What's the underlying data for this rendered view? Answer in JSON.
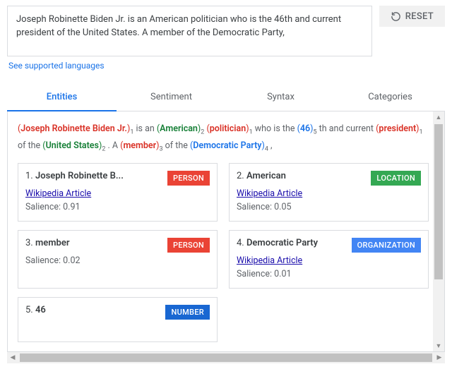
{
  "input_text": "Joseph Robinette Biden Jr. is an American politician who is the 46th and current president of the United States. A member of the Democratic Party,",
  "reset_label": "RESET",
  "supported_languages_label": "See supported languages",
  "tabs": [
    {
      "id": "entities",
      "label": "Entities"
    },
    {
      "id": "sentiment",
      "label": "Sentiment"
    },
    {
      "id": "syntax",
      "label": "Syntax"
    },
    {
      "id": "categories",
      "label": "Categories"
    }
  ],
  "active_tab": "entities",
  "analysis_tokens": [
    {
      "kind": "entity",
      "text": "Joseph Robinette Biden Jr.",
      "type": "PERSON",
      "mention_index": 1
    },
    {
      "kind": "text",
      "text": " is an "
    },
    {
      "kind": "entity",
      "text": "American",
      "type": "LOCATION",
      "mention_index": 2
    },
    {
      "kind": "text",
      "text": " "
    },
    {
      "kind": "entity",
      "text": "politician",
      "type": "PERSON",
      "mention_index": 1
    },
    {
      "kind": "text",
      "text": " who is the "
    },
    {
      "kind": "entity",
      "text": "46",
      "type": "NUMBER",
      "mention_index": 5
    },
    {
      "kind": "text",
      "text": " th and current "
    },
    {
      "kind": "entity",
      "text": "president",
      "type": "PERSON",
      "mention_index": 1
    },
    {
      "kind": "text",
      "text": " of the "
    },
    {
      "kind": "entity",
      "text": "United States",
      "type": "LOCATION",
      "mention_index": 2
    },
    {
      "kind": "text",
      "text": " . A "
    },
    {
      "kind": "entity",
      "text": "member",
      "type": "PERSON",
      "mention_index": 3
    },
    {
      "kind": "text",
      "text": " of the "
    },
    {
      "kind": "entity",
      "text": "Democratic Party",
      "type": "ORGANIZATION",
      "mention_index": 4
    },
    {
      "kind": "text",
      "text": " ,"
    }
  ],
  "salience_label": "Salience",
  "wiki_label": "Wikipedia Article",
  "entities": [
    {
      "index": 1,
      "name": "Joseph Robinette B...",
      "type": "PERSON",
      "wikipedia": true,
      "salience": "0.91"
    },
    {
      "index": 2,
      "name": "American",
      "type": "LOCATION",
      "wikipedia": true,
      "salience": "0.05"
    },
    {
      "index": 3,
      "name": "member",
      "type": "PERSON",
      "wikipedia": false,
      "salience": "0.02"
    },
    {
      "index": 4,
      "name": "Democratic Party",
      "type": "ORGANIZATION",
      "wikipedia": true,
      "salience": "0.01"
    },
    {
      "index": 5,
      "name": "46",
      "type": "NUMBER",
      "wikipedia": false,
      "salience": null
    }
  ]
}
